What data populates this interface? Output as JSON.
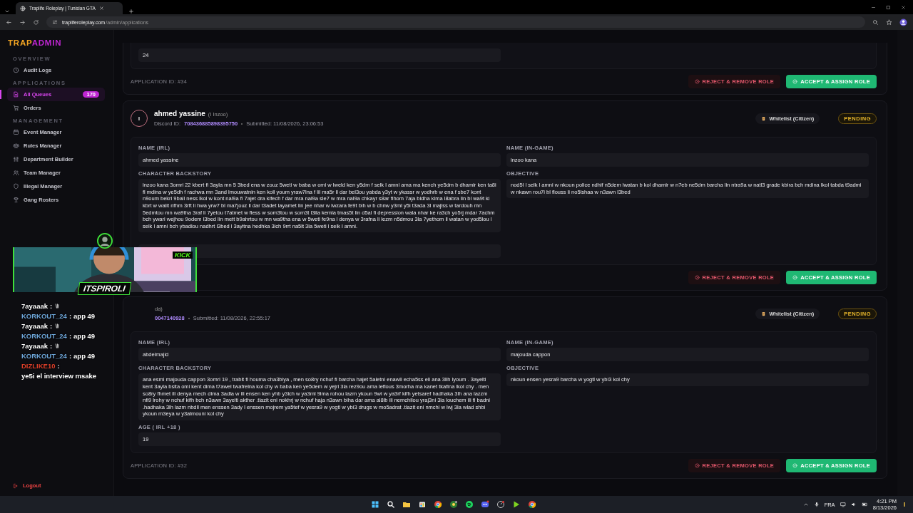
{
  "browser": {
    "tab_title": "Traplife Roleplay | Tunisian GTA",
    "url_host": "trapliferoleplay.com",
    "url_path": "/admin/applications"
  },
  "sidebar": {
    "logo_a": "TRAP",
    "logo_b": "ADMIN",
    "sections": [
      {
        "label": "OVERVIEW",
        "items": [
          {
            "label": "Audit Logs",
            "selected": false
          }
        ]
      },
      {
        "label": "APPLICATIONS",
        "items": [
          {
            "label": "All Queues",
            "selected": true,
            "badge": "170"
          },
          {
            "label": "Orders",
            "selected": false
          }
        ]
      },
      {
        "label": "MANAGEMENT",
        "items": [
          {
            "label": "Event Manager",
            "selected": false
          },
          {
            "label": "Rules Manager",
            "selected": false
          },
          {
            "label": "Department Builder",
            "selected": false
          },
          {
            "label": "Team Manager",
            "selected": false
          },
          {
            "label": "Illegal Manager",
            "selected": false
          },
          {
            "label": "Gang Rosters",
            "selected": false
          }
        ]
      }
    ],
    "logout": "Logout"
  },
  "cards": [
    {
      "left": [
        {
          "kind": "input",
          "value": "24"
        }
      ],
      "application_id": "APPLICATION ID: #34",
      "reject": "REJECT & REMOVE ROLE",
      "accept": "ACCEPT & ASSIGN ROLE"
    },
    {
      "header": {
        "avatar": "I",
        "name": "ahmed yassine",
        "nickname": "(I Inzoo)",
        "discord_label": "Discord ID:",
        "discord_id": "708436885898395750",
        "submitted": "Submitted: 11/08/2026, 23:06:53",
        "type": "Whitelist (Citizen)",
        "status": "PENDING"
      },
      "left": [
        {
          "kind": "input",
          "label": "NAME (IRL)",
          "value": "ahmed yassine"
        },
        {
          "kind": "area",
          "label": "CHARACTER BACKSTORY",
          "value": "inzoo kana 3omri 22 kbert fi 3ayla mn 5 3bed ena w zouz 5weti w baba w omi w lweld ken y5dm f selk l amni ama ma kench ye5dm b dhamir ken ta8i fl mdina w ye5dh f rachwa mn 3and lmouwatnin ken koll youm yraw7lna f lil ma5r ll dar bel3ou yabda y3yt w ykassr w yodhrb w ena f sbe7 kont n9oum bekri 9ball ness lkol w kont nal9a fi 7ajet dra kifech f dar mra nal9a sle7 w mra nal9a chkayr s8ar fihom 7aja bidha kima l8abra lin bl wa9t ki kbrt w walit nfhm 3rft li hwa yrw7 bl ma7jouz ll dar t3adet layamet lin jee nhar w lwzara fe9t bih w b chnw y3ml y5i t3ada 3l majlss w tardouh mn 5edmtou mn wa9tha 3raf li 7yetou t7atmet w fless w som3tou w som3t l3ila kemla tmas5t lin d5al fi depression wala nhar ke ra3ch yo5rj mdar 7achm bch ywari wejhou 9odem l3bed lin mett b9ahrtou w mn wa9tha ena w 5weti fe9na l denya w 3rafna li lezm n5dmou 3la 7yethom ll watan w yod5lou l selk l amni bch ybadlou nadhrt l3bed l 3ayltna hedhka 3lch 9rrt na5lt 3la 5weti l selk l amni."
        },
        {
          "kind": "covered"
        }
      ],
      "right": [
        {
          "kind": "input",
          "label": "NAME (IN-GAME)",
          "value": "inzoo kana"
        },
        {
          "kind": "area",
          "label": "OBJECTIVE",
          "value": "nod5l l selk l amni w nkoun police ndhif n5dem lwatan b kol dhamir w n7eb ne5dm barcha lin ntra9a w natl3 grade kbira bch mdina lkol tabda t9admi w nkawn rou7i bl flouss li no5lshaa w n3awn l3bed"
        }
      ],
      "reject": "REJECT & REMOVE ROLE",
      "accept": "ACCEPT & ASSIGN ROLE"
    },
    {
      "header": {
        "nickname": "da)",
        "discord_id": "0047140928",
        "submitted": "Submitted: 11/08/2026, 22:55:17",
        "type": "Whitelist (Citizen)",
        "status": "PENDING"
      },
      "left": [
        {
          "kind": "input",
          "label": "NAME (IRL)",
          "value": "abdelmajid"
        },
        {
          "kind": "area",
          "label": "CHARACTER BACKSTORY",
          "value": "ana esmi majouda cappon 3omri 19 , trabit fi houma cha3biya , men so8ry nchuf fi barcha hajet 5aletni enawli echa5ss eli ana 3lih lyoum . 3ayelti kent 3ayla bsita omi kent dima t7awel twafrelna kol chy w baba ken ye5dem w yejri 3la rez9ou ama leflous 3morha ma kanet tkafina lkol chy . men so8ry fhmet ili denya mech dima 3adla w ili ensen ken yhb y3ich w ya3ml 9ima rohou lazm ykoun 9wi w ya3rf kifh yetsaref hadhaka 3lh ana lazzm nfi9 lrohy w nchuf kifh bch n3awn 3ayelti akther .tlazit eni nokhrj w nchuf haja n3awn biha dar ama al8lb ili nemchilou yraj3ni 3la louchem ili fi badni .hadhaka 3lh lazm nbdll men enssen 3ady l enssen mojrem ya5tef w yesra9 w yogtl w ybi3 drugs w mo5adrat .tlazit eni nmchi w lwj 3la wlad shbi ykoun m3eya w y3almouni kol chy"
        },
        {
          "kind": "input",
          "label": "AGE ( IRL +18 )",
          "value": "19"
        }
      ],
      "right": [
        {
          "kind": "input",
          "label": "NAME (IN-GAME)",
          "value": "majouda cappon"
        },
        {
          "kind": "area",
          "label": "OBJECTIVE",
          "value": "nkoun ensen yesra9 barcha w yogtl w ybi3 kol chy"
        }
      ],
      "application_id": "APPLICATION ID: #32",
      "reject": "REJECT & REMOVE ROLE",
      "accept": "ACCEPT & ASSIGN ROLE"
    }
  ],
  "stream": {
    "streamer": "ITSPIROLI",
    "platform": "KICK"
  },
  "stream_chat": [
    {
      "kind": "emote",
      "user": "7ayaaak",
      "separator": ":",
      "color": "#ffffff"
    },
    {
      "kind": "text",
      "user": "KORKOUT_24",
      "separator": ":",
      "message": "app 49",
      "color": "#6fa8dc"
    },
    {
      "kind": "emote",
      "user": "7ayaaak",
      "separator": ":",
      "color": "#ffffff"
    },
    {
      "kind": "text",
      "user": "KORKOUT_24",
      "separator": ":",
      "message": "app 49",
      "color": "#6fa8dc"
    },
    {
      "kind": "emote",
      "user": "7ayaaak",
      "separator": ":",
      "color": "#ffffff"
    },
    {
      "kind": "text",
      "user": "KORKOUT_24",
      "separator": ":",
      "message": "app 49",
      "color": "#6fa8dc"
    },
    {
      "kind": "text",
      "user": "DIZLIKE10",
      "separator": ":",
      "message": "ye5i el interview msake",
      "color": "#e0402a"
    }
  ],
  "taskbar": {
    "language": "FRA",
    "time": "4:21 PM",
    "date": "8/13/2026"
  }
}
